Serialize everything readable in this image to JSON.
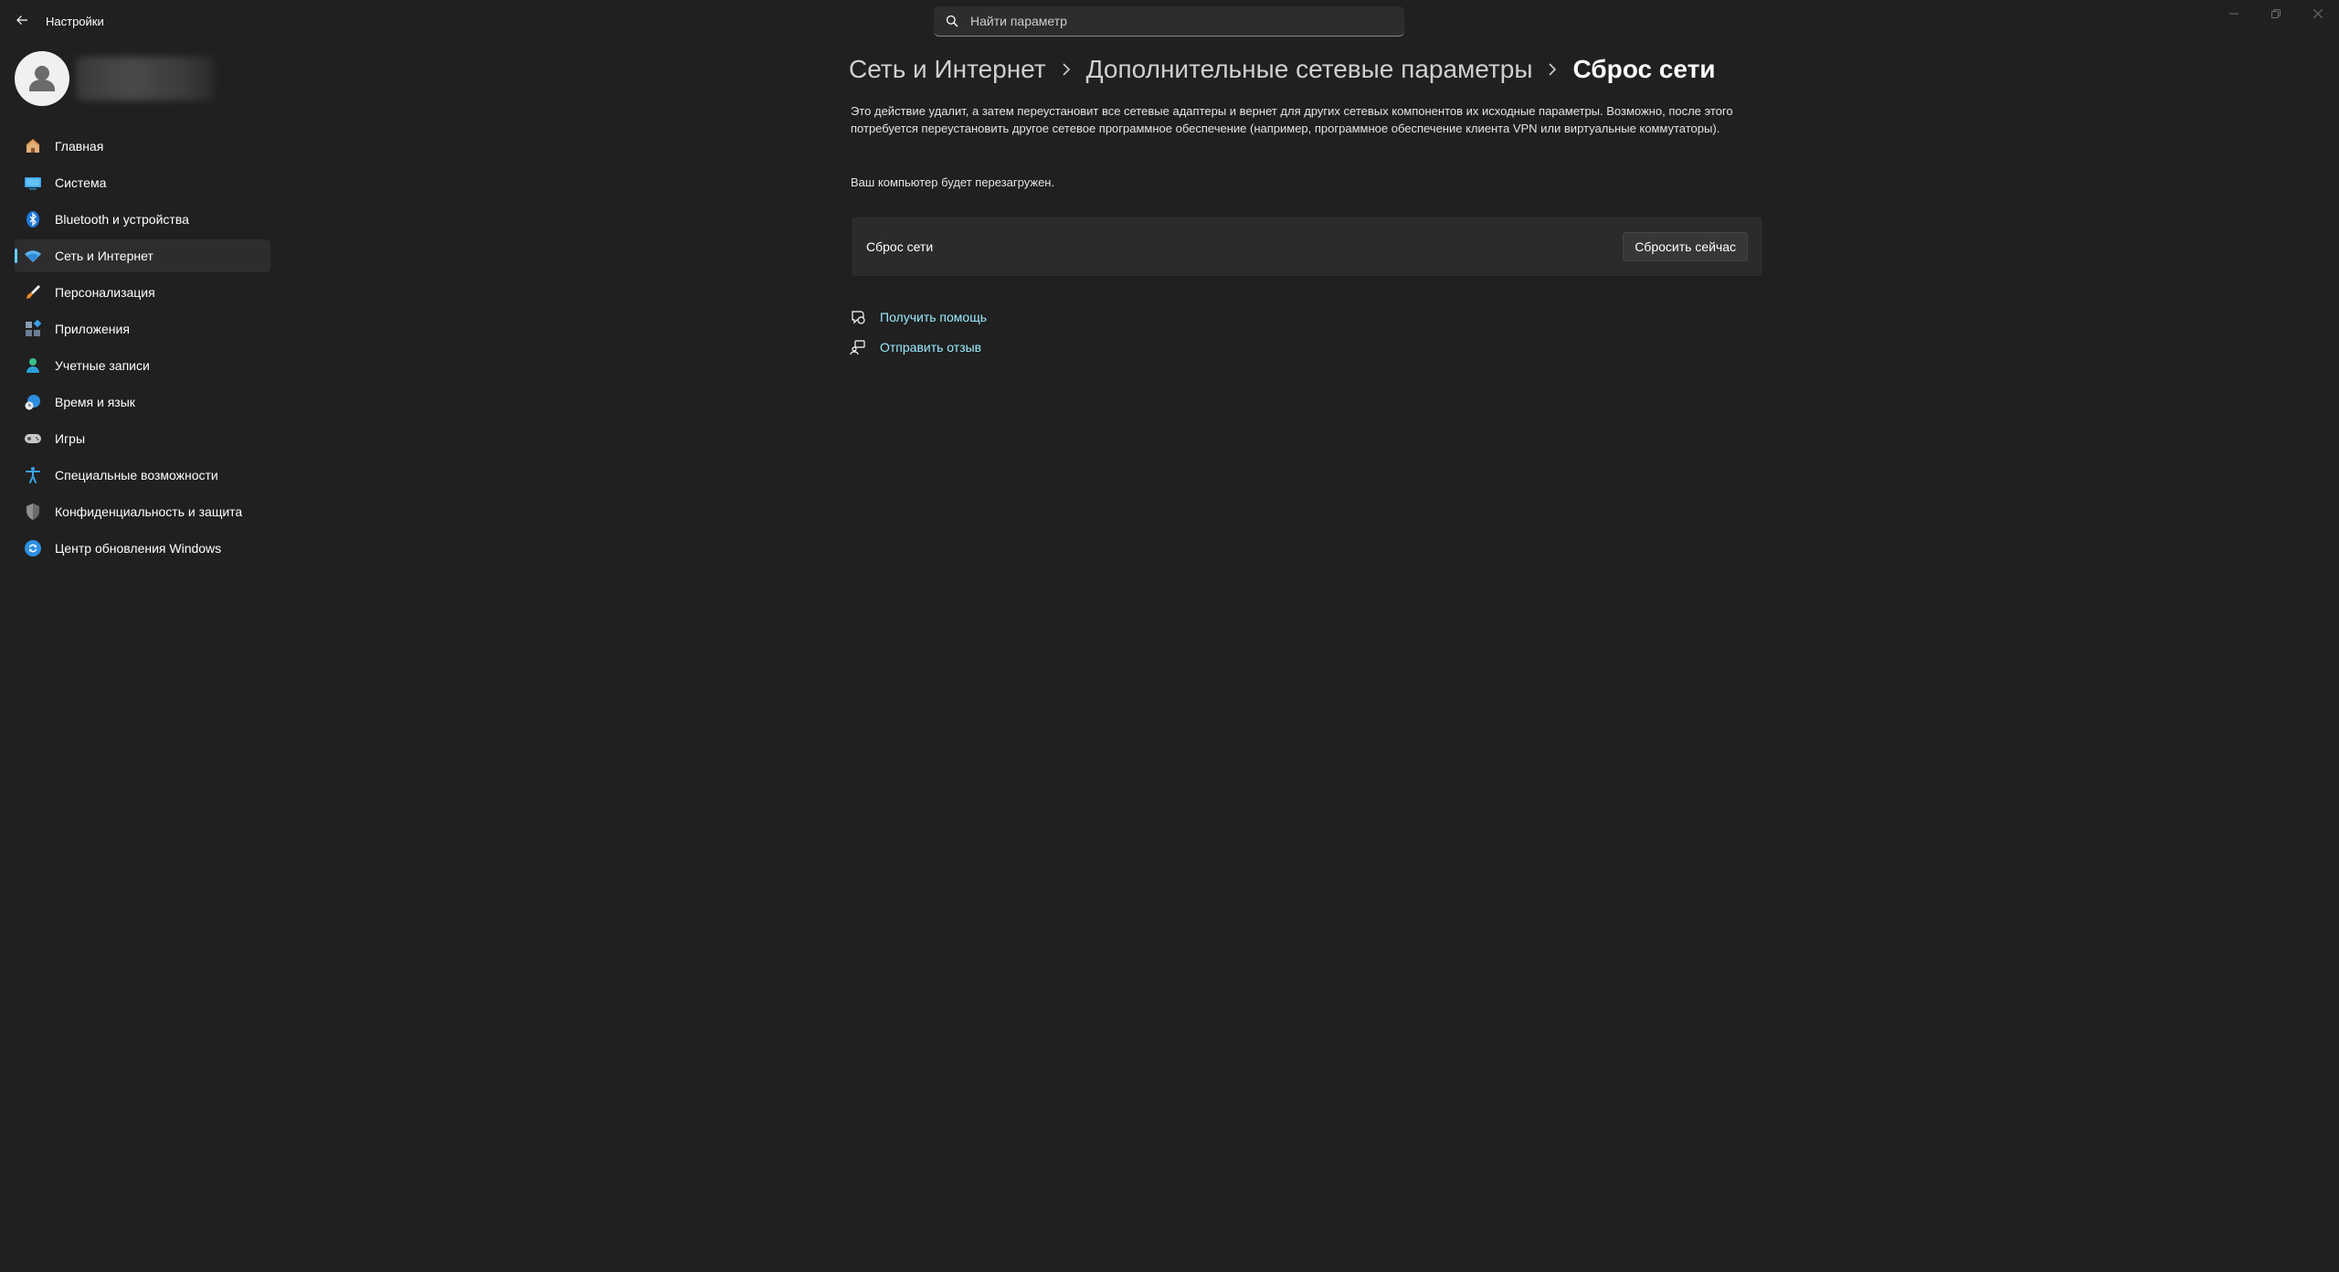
{
  "window": {
    "title": "Настройки",
    "accent": "#60cdff",
    "controls": [
      "minimize",
      "restore",
      "close"
    ]
  },
  "search": {
    "placeholder": "Найти параметр"
  },
  "sidebar": {
    "items": [
      {
        "label": "Главная",
        "icon": "home-icon"
      },
      {
        "label": "Система",
        "icon": "system-icon"
      },
      {
        "label": "Bluetooth и устройства",
        "icon": "bluetooth-icon"
      },
      {
        "label": "Сеть и Интернет",
        "icon": "network-icon",
        "active": true
      },
      {
        "label": "Персонализация",
        "icon": "brush-icon"
      },
      {
        "label": "Приложения",
        "icon": "apps-icon"
      },
      {
        "label": "Учетные записи",
        "icon": "accounts-icon"
      },
      {
        "label": "Время и язык",
        "icon": "time-language-icon"
      },
      {
        "label": "Игры",
        "icon": "gaming-icon"
      },
      {
        "label": "Специальные возможности",
        "icon": "accessibility-icon"
      },
      {
        "label": "Конфиденциальность и защита",
        "icon": "shield-icon"
      },
      {
        "label": "Центр обновления Windows",
        "icon": "update-icon"
      }
    ]
  },
  "breadcrumb": {
    "items": [
      "Сеть и Интернет",
      "Дополнительные сетевые параметры",
      "Сброс сети"
    ]
  },
  "main": {
    "description": "Это действие удалит, а затем переустановит все сетевые адаптеры и вернет для других сетевых компонентов их исходные параметры. Возможно, после этого потребуется переустановить другое сетевое программное обеспечение (например, программное обеспечение клиента VPN или виртуальные коммутаторы).",
    "reboot_note": "Ваш компьютер будет перезагружен.",
    "card": {
      "title": "Сброс сети",
      "button": "Сбросить сейчас"
    },
    "links": [
      {
        "label": "Получить помощь",
        "icon": "help-icon"
      },
      {
        "label": "Отправить отзыв",
        "icon": "feedback-icon"
      }
    ]
  }
}
